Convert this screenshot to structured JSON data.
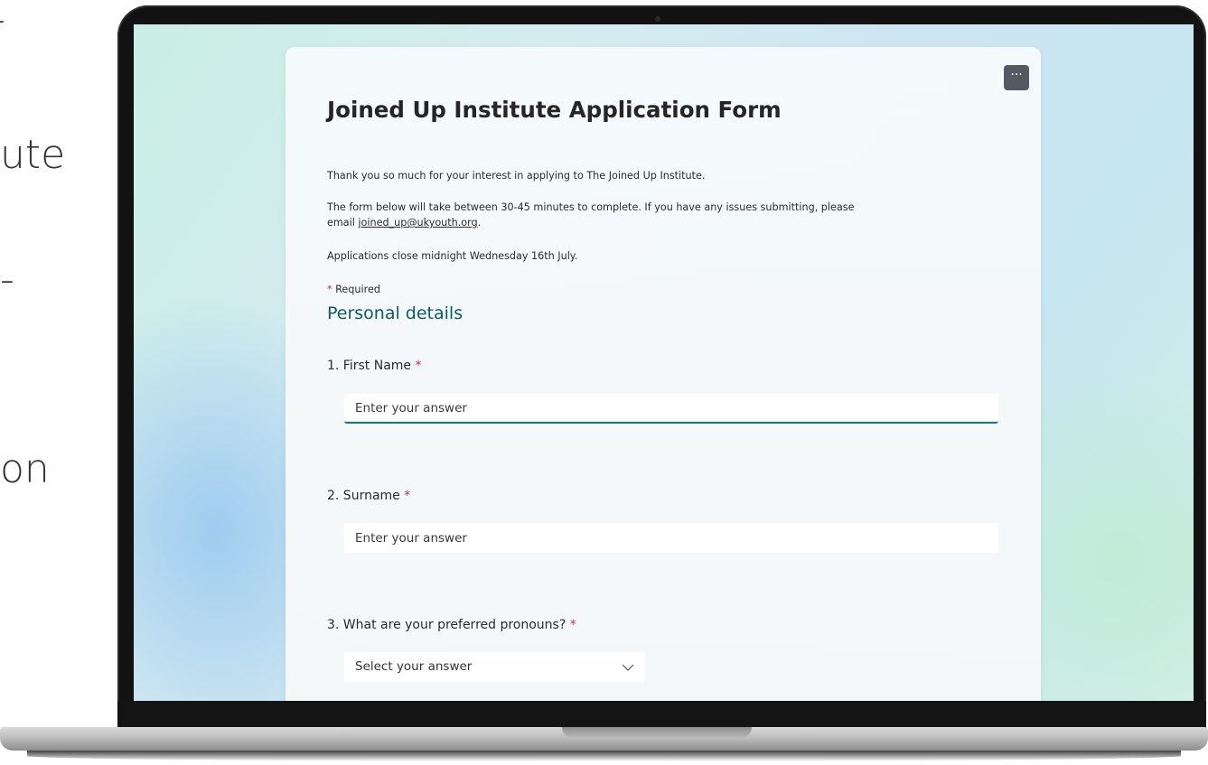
{
  "slide_edge_text": [
    "-",
    "ute",
    "-",
    "on"
  ],
  "form": {
    "more_label": "···",
    "title": "Joined Up Institute Application Form",
    "intro_line_1": "Thank you so much for your interest in applying to The Joined Up Institute.",
    "intro_line_2": "The form below will take between 30-45 minutes to complete. If you have any issues submitting, please",
    "intro_email_prefix": "email ",
    "intro_email": "joined_up@ukyouth.org",
    "intro_email_suffix": ".",
    "intro_line_4": "Applications close midnight Wednesday 16th July.",
    "required_mark": "*",
    "required_label": "Required",
    "section_title": "Personal details",
    "questions": [
      {
        "label": "1. First Name",
        "placeholder": "Enter your answer"
      },
      {
        "label": "2. Surname",
        "placeholder": "Enter your answer"
      },
      {
        "label": "3. What are your preferred pronouns?",
        "selected": "Select your answer"
      }
    ]
  },
  "colors": {
    "accent": "#0c7a7f",
    "section_title": "#0c5a61",
    "required": "#c4314b"
  }
}
